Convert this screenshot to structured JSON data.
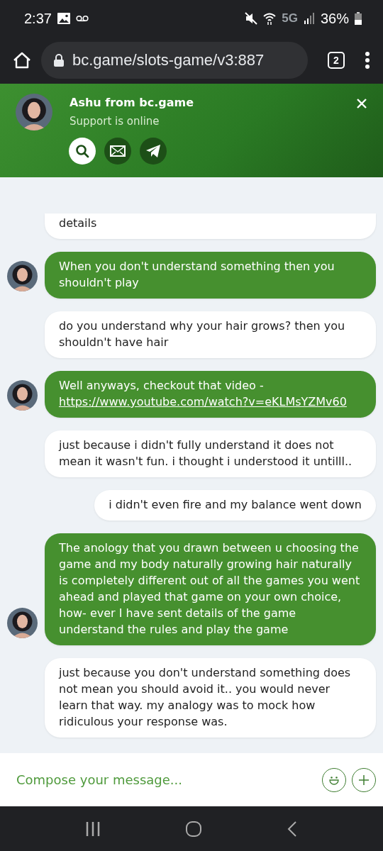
{
  "status_bar": {
    "time": "2:37",
    "network": "5G",
    "battery": "36%"
  },
  "browser": {
    "url": "bc.game/slots-game/v3:887",
    "tab_count": "2"
  },
  "chat_header": {
    "name": "Ashu from bc.game",
    "status": "Support is online",
    "actions": [
      {
        "kind": "search",
        "selected": true
      },
      {
        "kind": "mail",
        "selected": false
      },
      {
        "kind": "telegram",
        "selected": false
      }
    ]
  },
  "messages": [
    {
      "kind": "user",
      "continued": true,
      "text": "details"
    },
    {
      "kind": "agent",
      "text": "When you don't understand something then you shouldn't play"
    },
    {
      "kind": "user",
      "text": "do you understand why your hair grows? then you shouldn't have hair"
    },
    {
      "kind": "agent",
      "text": "Well anyways, checkout that video -",
      "link": "https://www.youtube.com/watch?v=eKLMsYZMv60"
    },
    {
      "kind": "user",
      "text": "just because i didn't fully understand it does not mean it wasn't fun. i thought i understood it untilll.."
    },
    {
      "kind": "user",
      "text": "i didn't even fire and my balance went down"
    },
    {
      "kind": "agent",
      "text": "The anology that you drawn between u choosing the game and my body naturally growing hair naturally is completely different out of all the games you went ahead and played that game on your own choice, how- ever I have sent details of the game understand the rules and play the game"
    },
    {
      "kind": "user",
      "text": "just because you don't understand something does not mean you should avoid it.. you would never learn that way. my analogy was to mock how ridiculous your response was."
    }
  ],
  "composer": {
    "placeholder": "Compose your message..."
  }
}
